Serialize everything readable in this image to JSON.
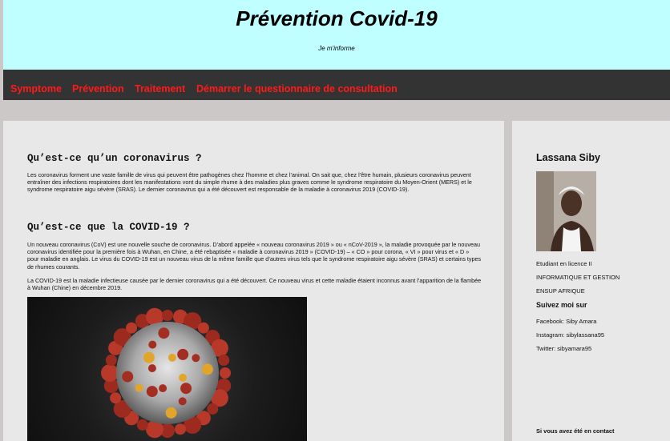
{
  "header": {
    "title": "Prévention Covid-19",
    "tagline": "Je m'informe",
    "background": "#bfffff"
  },
  "nav": {
    "link_color": "#ff1a1a",
    "items": [
      {
        "label": "Symptome"
      },
      {
        "label": "Prévention"
      },
      {
        "label": "Traitement"
      },
      {
        "label": "Démarrer le questionnaire de consultation"
      }
    ]
  },
  "article": {
    "sections": [
      {
        "heading": "Qu’est-ce qu’un coronavirus ?",
        "paragraphs": [
          "Les coronavirus forment une vaste famille de virus qui peuvent être pathogènes chez l’homme et chez l’animal. On sait que, chez l’être humain, plusieurs coronavirus peuvent entraîner des infections respiratoires dont les manifestations vont du simple rhume à des maladies plus graves comme le syndrome respiratoire du Moyen-Orient (MERS) et le syndrome respiratoire aigu sévère (SRAS). Le dernier coronavirus qui a été découvert est responsable de la maladie à coronavirus 2019 (COVID-19)."
        ]
      },
      {
        "heading": "Qu’est-ce que la COVID-19 ?",
        "paragraphs": [
          "Un nouveau coronavirus (CoV) est une nouvelle souche de coronavirus. D’abord appelée « nouveau coronavirus 2019 » ou « nCoV-2019 », la maladie provoquée par le nouveau coronavirus identifiée pour la première fois à Wuhan, en Chine, a été rebaptisée « maladie à coronavirus 2019 » (COVID-19) – « CO » pour corona, « VI » pour virus et « D » pour maladie en anglais. Le virus du COVID-19 est un nouveau virus de la même famille que d’autres virus tels que le syndrome respiratoire aigu sévère (SRAS) et certains types de rhumes courants.",
          "La COVID-19 est la maladie infectieuse causée par le dernier coronavirus qui a été découvert. Ce nouveau virus et cette maladie étaient inconnus avant l’apparition de la flambée à Wuhan (Chine) en décembre 2019."
        ]
      }
    ],
    "image_icon": "coronavirus-illustration"
  },
  "sidebar": {
    "author_name": "Lassana Siby",
    "avatar_icon": "profile-photo",
    "info_lines": [
      "Etudiant en licence II",
      "INFORMATIQUE ET GESTION",
      "ENSUP AFRIQUE"
    ],
    "follow_heading": "Suivez moi sur",
    "social": [
      "Facebook: Siby Amara",
      "Instagram: sibylassana95",
      "Twitter: sibyamara95"
    ],
    "contact_note": "Si vous avez été en contact"
  }
}
